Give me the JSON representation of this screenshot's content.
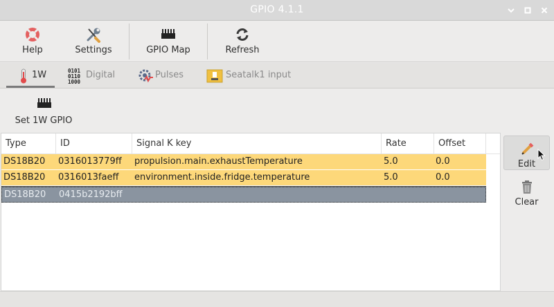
{
  "window": {
    "title": "GPIO 4.1.1",
    "controls": [
      {
        "name": "minimize",
        "icon": "minimize-icon"
      },
      {
        "name": "maximize",
        "icon": "maximize-icon"
      },
      {
        "name": "close",
        "icon": "close-icon"
      }
    ]
  },
  "toolbar": {
    "buttons": [
      {
        "label": "Help",
        "icon": "lifebuoy-icon"
      },
      {
        "label": "Settings",
        "icon": "wrench-screwdriver-icon"
      },
      {
        "label": "GPIO Map",
        "icon": "chip-icon"
      },
      {
        "label": "Refresh",
        "icon": "refresh-icon"
      }
    ]
  },
  "tabs": [
    {
      "label": "1W",
      "icon": "thermometer-icon",
      "active": true
    },
    {
      "label": "Digital",
      "icon": "binary-icon",
      "active": false
    },
    {
      "label": "Pulses",
      "icon": "gear-pulse-icon",
      "active": false
    },
    {
      "label": "Seatalk1 input",
      "icon": "seatalk-icon",
      "active": false
    }
  ],
  "onewire": {
    "set_gpio_label": "Set 1W GPIO",
    "columns": [
      "Type",
      "ID",
      "Signal K key",
      "Rate",
      "Offset"
    ],
    "rows": [
      {
        "type": "DS18B20",
        "id": "0316013779ff",
        "sk_key": "propulsion.main.exhaustTemperature",
        "rate": "5.0",
        "offset": "0.0",
        "state": "highlight"
      },
      {
        "type": "DS18B20",
        "id": "0316013faeff",
        "sk_key": "environment.inside.fridge.temperature",
        "rate": "5.0",
        "offset": "0.0",
        "state": "highlight"
      },
      {
        "type": "DS18B20",
        "id": "0415b2192bff",
        "sk_key": "",
        "rate": "",
        "offset": "",
        "state": "selected"
      }
    ]
  },
  "side_panel": {
    "edit_label": "Edit",
    "clear_label": "Clear"
  },
  "colors": {
    "highlight_row": "#fdd87a",
    "selected_row": "#8a94a0",
    "titlebar": "#d9d9d9"
  }
}
